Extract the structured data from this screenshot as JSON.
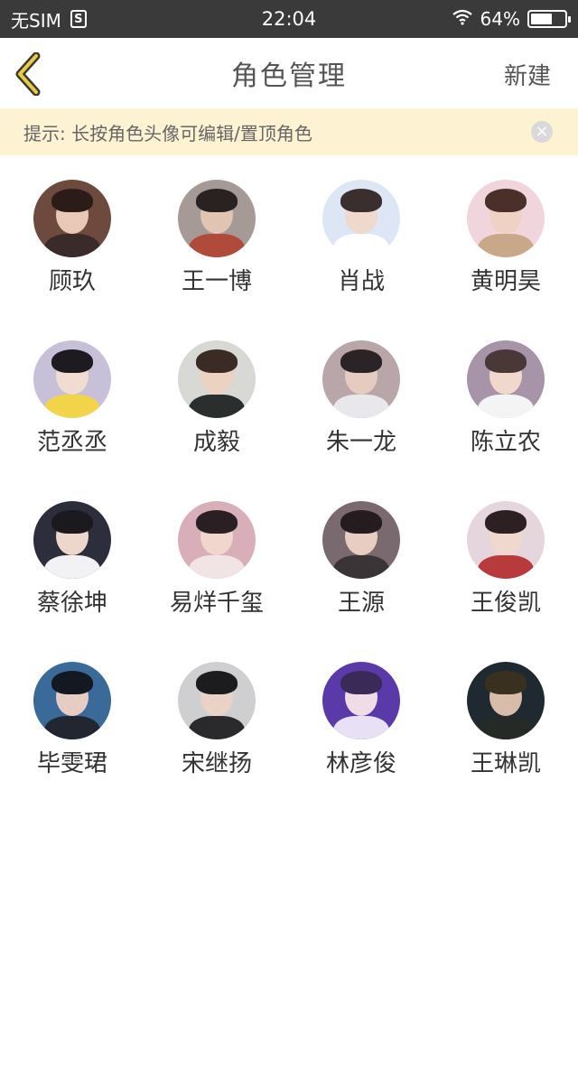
{
  "status_bar": {
    "carrier": "无SIM",
    "sim_badge": "S",
    "time": "22:04",
    "battery": "64%",
    "battery_level": 0.64
  },
  "nav": {
    "title": "角色管理",
    "new_label": "新建"
  },
  "tip": {
    "text": "提示: 长按角色头像可编辑/置顶角色",
    "close_glyph": "×"
  },
  "roles": [
    {
      "name": "顾玖",
      "bg": "#6e4a3e",
      "hair": "#2b1c18",
      "skin": "#e8c9b8",
      "body": "#3a2a2a"
    },
    {
      "name": "王一博",
      "bg": "#a59a95",
      "hair": "#2a2220",
      "skin": "#e2c4b2",
      "body": "#b04a3a"
    },
    {
      "name": "肖战",
      "bg": "#dce6f4",
      "hair": "#3a2e2e",
      "skin": "#f0d8cc",
      "body": "#ffffff"
    },
    {
      "name": "黄明昊",
      "bg": "#f0d6dc",
      "hair": "#4a3028",
      "skin": "#efd2c4",
      "body": "#c9a88a"
    },
    {
      "name": "范丞丞",
      "bg": "#c8c0d8",
      "hair": "#1e1a22",
      "skin": "#f0dcd0",
      "body": "#f2d44a"
    },
    {
      "name": "成毅",
      "bg": "#d8d8d4",
      "hair": "#3a2c24",
      "skin": "#ecd2c2",
      "body": "#2a2e2c"
    },
    {
      "name": "朱一龙",
      "bg": "#b8a6a8",
      "hair": "#2a2426",
      "skin": "#e6ccc0",
      "body": "#e8e8ec"
    },
    {
      "name": "陈立农",
      "bg": "#a894a8",
      "hair": "#4a3838",
      "skin": "#f0d8cc",
      "body": "#f4f4f4"
    },
    {
      "name": "蔡徐坤",
      "bg": "#2c2e3c",
      "hair": "#1a1a1e",
      "skin": "#eed6cc",
      "body": "#f2f2f4"
    },
    {
      "name": "易烊千玺",
      "bg": "#d8aeb8",
      "hair": "#2a2024",
      "skin": "#f0d6cc",
      "body": "#f0e4e4"
    },
    {
      "name": "王源",
      "bg": "#7a6a70",
      "hair": "#241c1e",
      "skin": "#e8cec2",
      "body": "#3a3436"
    },
    {
      "name": "王俊凯",
      "bg": "#e4d6dc",
      "hair": "#2c2022",
      "skin": "#f0d8ce",
      "body": "#b83a3a"
    },
    {
      "name": "毕雯珺",
      "bg": "#3a6a9a",
      "hair": "#141820",
      "skin": "#e6ccc2",
      "body": "#222630"
    },
    {
      "name": "宋继扬",
      "bg": "#cfcfd2",
      "hair": "#1c1c1e",
      "skin": "#ead2c6",
      "body": "#2a2a2c"
    },
    {
      "name": "林彦俊",
      "bg": "#5a3aa8",
      "hair": "#3a2a58",
      "skin": "#f0dce6",
      "body": "#e8e0f4"
    },
    {
      "name": "王琳凯",
      "bg": "#1e2a30",
      "hair": "#3a3020",
      "skin": "#d8bcaa",
      "body": "#262a26"
    }
  ]
}
